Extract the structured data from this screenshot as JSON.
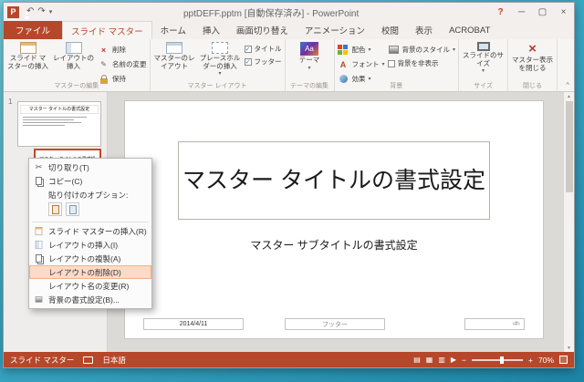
{
  "accent": "#B7472A",
  "titlebar": {
    "title": "pptDEFF.pptm [自動保存済み] - PowerPoint"
  },
  "icons": {
    "logo": "P",
    "undo": "↶",
    "redo": "↷",
    "dropdown": "▾",
    "help": "?",
    "minimize": "─",
    "maximize": "▢",
    "close_window": "×",
    "collapse_ribbon": "^",
    "cut": "✂",
    "rename": "✎",
    "delete": "×",
    "check": "✓",
    "theme_letters": "Aa",
    "font_letter": "A",
    "view_normal": "▤",
    "view_sorter": "▦",
    "view_reading": "▥",
    "view_slideshow": "▶",
    "zoom_out": "−",
    "zoom_in": "+",
    "close_master": "×",
    "scroll_up": "▲",
    "scroll_down": "▼"
  },
  "tabs": [
    {
      "label": "ファイル"
    },
    {
      "label": "スライド マスター"
    },
    {
      "label": "ホーム"
    },
    {
      "label": "挿入"
    },
    {
      "label": "画面切り替え"
    },
    {
      "label": "アニメーション"
    },
    {
      "label": "校閲"
    },
    {
      "label": "表示"
    },
    {
      "label": "ACROBAT"
    }
  ],
  "ribbon": {
    "groups": [
      {
        "name": "マスターの編集",
        "insert_master": "スライド マスターの挿入",
        "insert_layout": "レイアウトの挿入",
        "delete": "削除",
        "rename": "名前の変更",
        "preserve": "保持"
      },
      {
        "name": "マスター レイアウト",
        "master_layout": "マスターのレイアウト",
        "insert_placeholder": "プレースホルダーの挿入",
        "title_check": "タイトル",
        "footer_check": "フッター"
      },
      {
        "name": "テーマの編集",
        "themes": "テーマ"
      },
      {
        "name": "背景",
        "colors": "配色",
        "fonts": "フォント",
        "effects": "効果",
        "bg_styles": "背景のスタイル",
        "hide_bg": "背景を非表示"
      },
      {
        "name": "サイズ",
        "slide_size": "スライドのサイズ"
      },
      {
        "name": "閉じる",
        "close_master": "マスター表示を閉じる"
      }
    ]
  },
  "thumbnails": {
    "index": "1",
    "master_title": "マスター タイトルの書式設定"
  },
  "context_menu": {
    "cut": "切り取り(T)",
    "copy": "コピー(C)",
    "paste_options": "貼り付けのオプション:",
    "insert_master": "スライド マスターの挿入(R)",
    "insert_layout": "レイアウトの挿入(I)",
    "duplicate_layout": "レイアウトの複製(A)",
    "delete_layout": "レイアウトの削除(D)",
    "rename_layout": "レイアウト名の変更(R)",
    "format_background": "背景の書式設定(B)..."
  },
  "slide": {
    "title": "マスター タイトルの書式設定",
    "subtitle": "マスター サブタイトルの書式設定",
    "date": "2014/4/11",
    "footer": "フッター",
    "number": "‹#›"
  },
  "statusbar": {
    "view_name": "スライド マスター",
    "language": "日本語",
    "zoom": "70%"
  }
}
